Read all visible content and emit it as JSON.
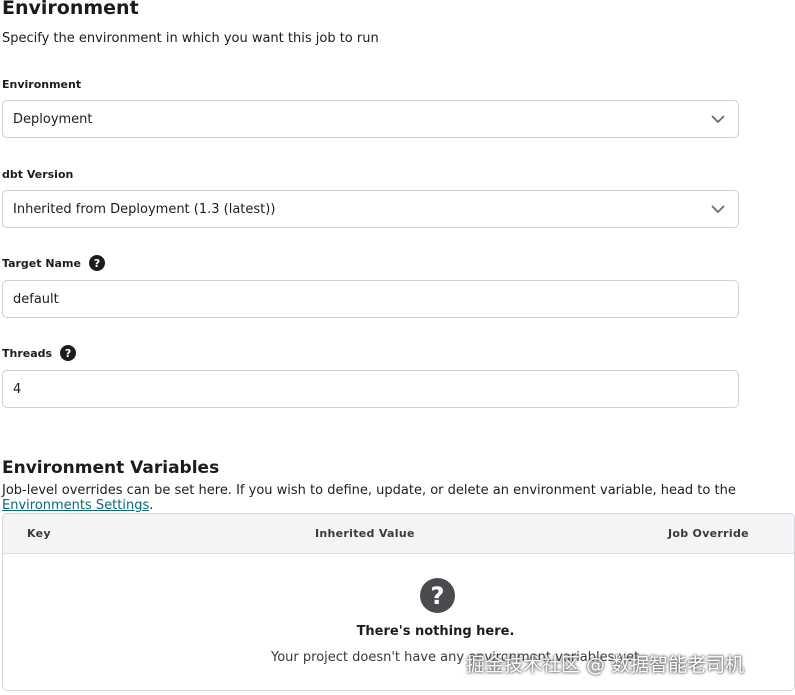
{
  "environment_section": {
    "title": "Environment",
    "subtitle": "Specify the environment in which you want this job to run"
  },
  "fields": {
    "environment": {
      "label": "Environment",
      "value": "Deployment"
    },
    "dbt_version": {
      "label": "dbt Version",
      "value": "Inherited from Deployment (1.3 (latest))"
    },
    "target_name": {
      "label": "Target Name",
      "value": "default"
    },
    "threads": {
      "label": "Threads",
      "value": "4"
    }
  },
  "env_vars_section": {
    "title": "Environment Variables",
    "subtitle_prefix": "Job-level overrides can be set here. If you wish to define, update, or delete an environment variable, head to the ",
    "link_text": "Environments Settings",
    "subtitle_suffix": "."
  },
  "table": {
    "columns": [
      "Key",
      "Inherited Value",
      "Job Override"
    ],
    "empty_title": "There's nothing here.",
    "empty_description": "Your project doesn't have any environment variables yet."
  },
  "watermark": "掘金技术社区 @ 数据智能老司机",
  "icons": {
    "help": "question-circle-icon",
    "dropdown": "chevron-down-icon",
    "empty": "question-circle-icon"
  }
}
